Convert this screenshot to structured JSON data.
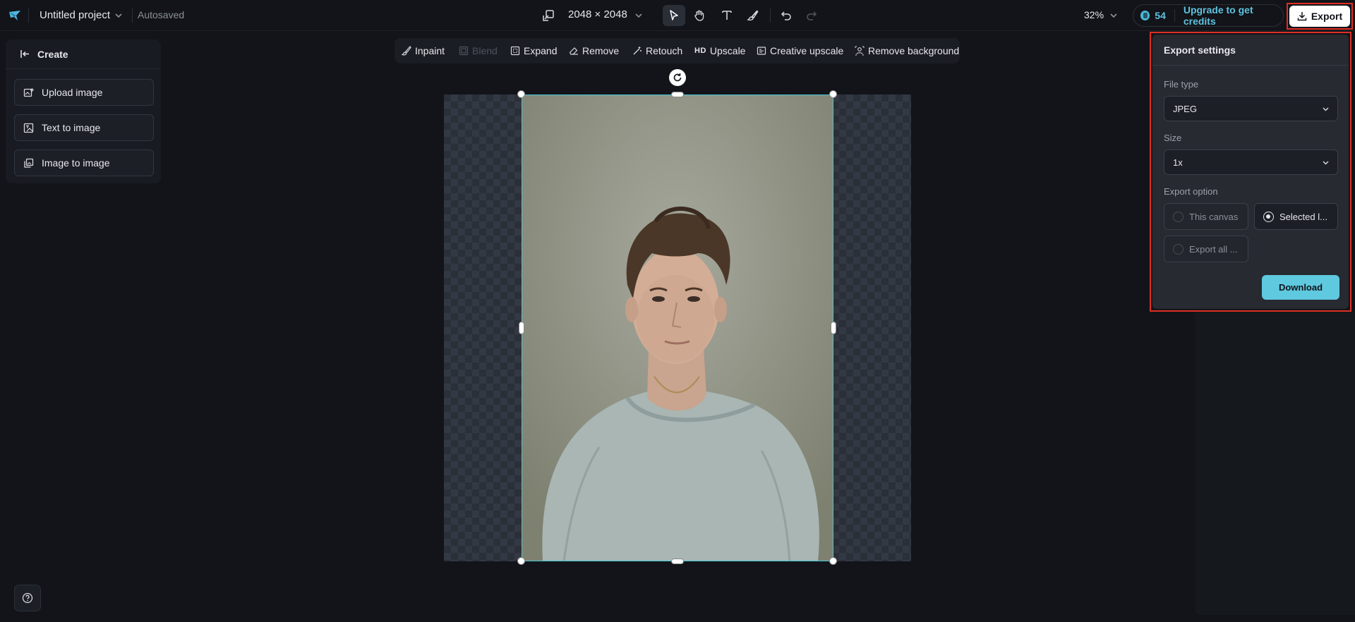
{
  "header": {
    "project_name": "Untitled project",
    "autosave_status": "Autosaved",
    "canvas_size": "2048 × 2048",
    "zoom": "32%",
    "credits": "54",
    "upgrade_label": "Upgrade to get credits",
    "export_label": "Export"
  },
  "tools": [
    "select-tool",
    "hand-tool",
    "text-tool",
    "brush-tool",
    "undo",
    "redo"
  ],
  "create_panel": {
    "title": "Create",
    "buttons": [
      "Upload image",
      "Text to image",
      "Image to image"
    ]
  },
  "edit_toolbar": {
    "inpaint": "Inpaint",
    "blend": "Blend",
    "expand": "Expand",
    "remove": "Remove",
    "retouch": "Retouch",
    "hd_tag": "HD",
    "upscale": "Upscale",
    "creative_upscale": "Creative upscale",
    "remove_background": "Remove background"
  },
  "export_settings": {
    "title": "Export settings",
    "file_type_label": "File type",
    "file_type_value": "JPEG",
    "size_label": "Size",
    "size_value": "1x",
    "export_option_label": "Export option",
    "option_this_canvas": "This canvas",
    "option_selected": "Selected l...",
    "option_export_all": "Export all ...",
    "selected_option": "Selected l...",
    "download_label": "Download"
  },
  "colors": {
    "accent": "#5ec9df",
    "selection": "#45c6d6",
    "highlight": "#e02e24"
  }
}
